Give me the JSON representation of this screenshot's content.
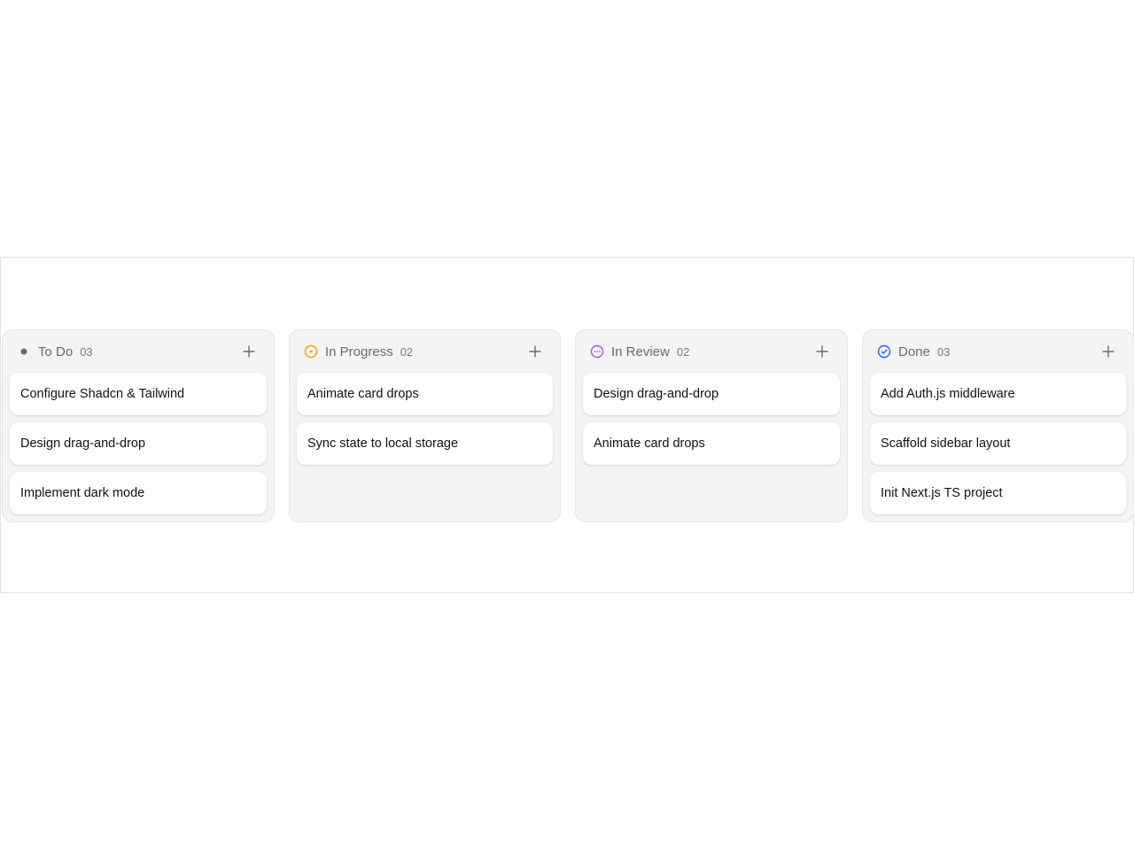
{
  "colors": {
    "todo": "#6b6b6b",
    "in_progress": "#f59e0b",
    "in_review": "#a855f7",
    "done": "#2563eb"
  },
  "columns": [
    {
      "title": "To Do",
      "count": "03",
      "icon": "dot-icon",
      "cards": [
        "Configure Shadcn & Tailwind",
        "Design drag-and-drop",
        "Implement dark mode"
      ]
    },
    {
      "title": "In Progress",
      "count": "02",
      "icon": "in-progress-circle-icon",
      "cards": [
        "Animate card drops",
        "Sync state to local storage"
      ]
    },
    {
      "title": "In Review",
      "count": "02",
      "icon": "in-review-circle-icon",
      "cards": [
        "Design drag-and-drop",
        "Animate card drops"
      ]
    },
    {
      "title": "Done",
      "count": "03",
      "icon": "check-circle-icon",
      "cards": [
        "Add Auth.js middleware",
        "Scaffold sidebar layout",
        "Init Next.js TS project"
      ]
    }
  ]
}
